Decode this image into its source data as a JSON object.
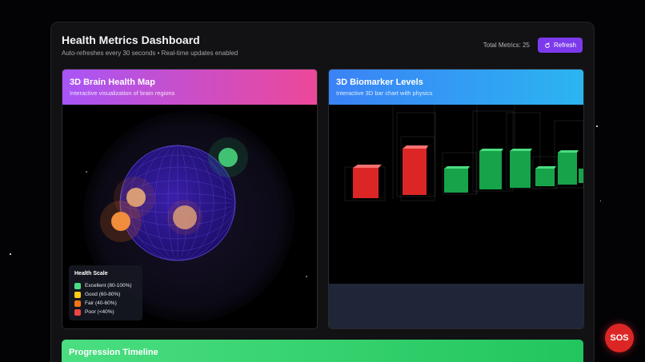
{
  "header": {
    "title": "Health Metrics Dashboard",
    "subtitle": "Auto-refreshes every 30 seconds • Real-time updates enabled",
    "total_metrics": "Total Metrics: 25",
    "refresh_label": "Refresh"
  },
  "brain_card": {
    "title": "3D Brain Health Map",
    "subtitle": "Interactive visualization of brain regions",
    "legend": {
      "title": "Health Scale",
      "items": [
        {
          "label": "Excellent (80-100%)",
          "color": "#4ade80"
        },
        {
          "label": "Good (60-80%)",
          "color": "#facc15"
        },
        {
          "label": "Fair (40-60%)",
          "color": "#f97316"
        },
        {
          "label": "Poor (<40%)",
          "color": "#ef4444"
        }
      ]
    }
  },
  "biomarker_card": {
    "title": "3D Biomarker Levels",
    "subtitle": "Interactive 3D bar chart with physics"
  },
  "timeline": {
    "title": "Progression Timeline"
  },
  "sos_label": "SOS",
  "colors": {
    "accent": "#7c3aed",
    "danger": "#dc2626",
    "brain_gradient": [
      "#a855f7",
      "#ec4899"
    ],
    "bio_gradient": [
      "#3b82f6",
      "#22d3ee"
    ],
    "timeline_gradient": [
      "#4ade80",
      "#22c55e"
    ]
  }
}
